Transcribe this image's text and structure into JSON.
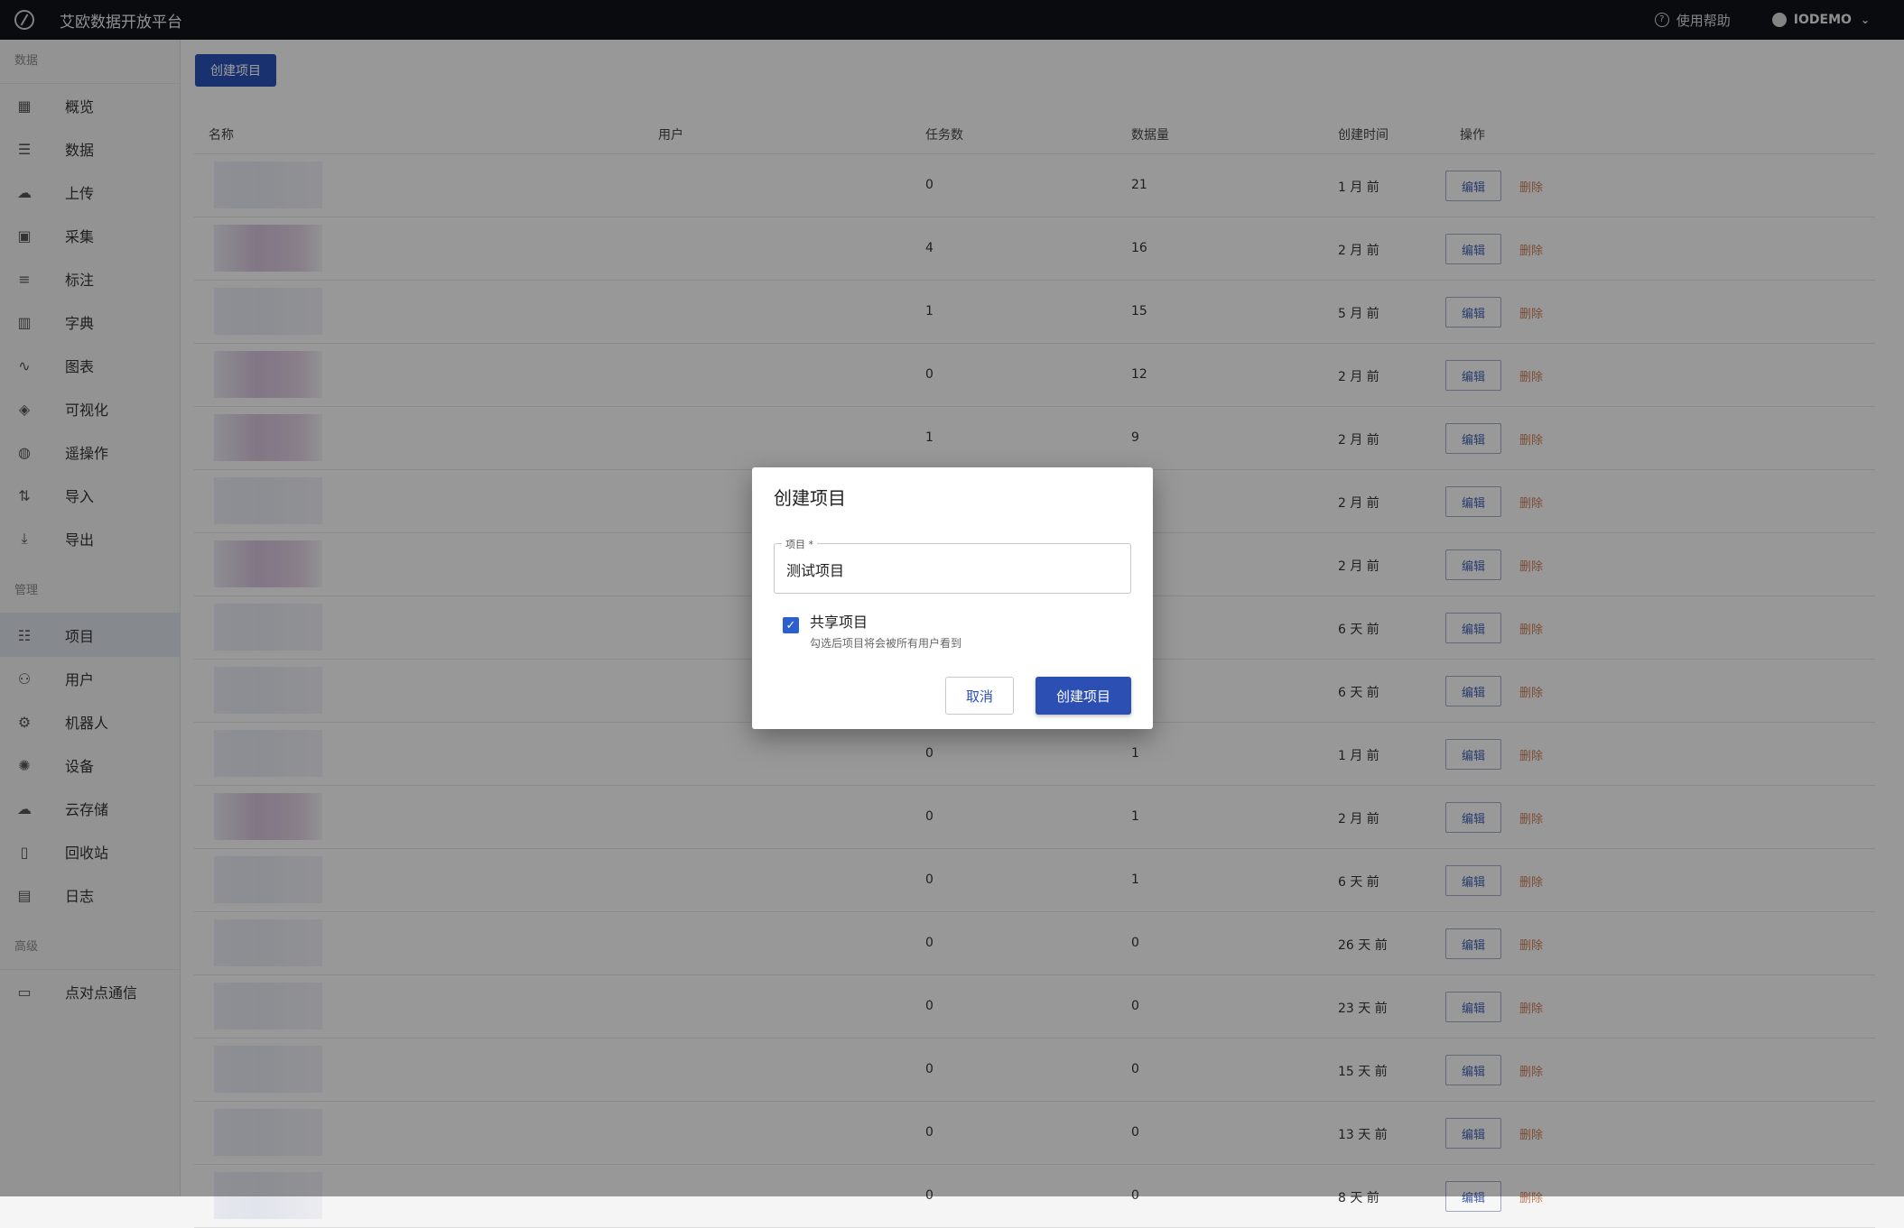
{
  "app": {
    "title": "艾欧数据开放平台"
  },
  "header": {
    "help_label": "使用帮助",
    "user_label": "IODEMO"
  },
  "sidebar": {
    "section_data": "数据",
    "section_manage": "管理",
    "section_advanced": "高级",
    "data_items": [
      {
        "label": "概览",
        "icon": "dashboard-icon"
      },
      {
        "label": "数据",
        "icon": "list-icon"
      },
      {
        "label": "上传",
        "icon": "cloud-upload-icon"
      },
      {
        "label": "采集",
        "icon": "video-icon"
      },
      {
        "label": "标注",
        "icon": "bullet-list-icon"
      },
      {
        "label": "字典",
        "icon": "book-icon"
      },
      {
        "label": "图表",
        "icon": "chart-icon"
      },
      {
        "label": "可视化",
        "icon": "visual-icon"
      },
      {
        "label": "遥操作",
        "icon": "gamepad-icon"
      },
      {
        "label": "导入",
        "icon": "import-icon"
      },
      {
        "label": "导出",
        "icon": "download-icon"
      }
    ],
    "manage_items": [
      {
        "label": "项目",
        "icon": "project-icon"
      },
      {
        "label": "用户",
        "icon": "users-icon"
      },
      {
        "label": "机器人",
        "icon": "robot-icon"
      },
      {
        "label": "设备",
        "icon": "device-icon"
      },
      {
        "label": "云存储",
        "icon": "cloud-icon"
      },
      {
        "label": "回收站",
        "icon": "trash-icon"
      },
      {
        "label": "日志",
        "icon": "clipboard-icon"
      }
    ],
    "advanced_items": [
      {
        "label": "点对点通信",
        "icon": "chat-icon"
      }
    ]
  },
  "main": {
    "create_button": "创建项目",
    "columns": {
      "name": "名称",
      "user": "用户",
      "tasks": "任务数",
      "data": "数据量",
      "created": "创建时间",
      "actions": "操作"
    },
    "edit_label": "编辑",
    "delete_label": "删除",
    "rows": [
      {
        "tasks": "0",
        "data": "21",
        "created": "1 月 前"
      },
      {
        "tasks": "4",
        "data": "16",
        "created": "2 月 前"
      },
      {
        "tasks": "1",
        "data": "15",
        "created": "5 月 前"
      },
      {
        "tasks": "0",
        "data": "12",
        "created": "2 月 前"
      },
      {
        "tasks": "1",
        "data": "9",
        "created": "2 月 前"
      },
      {
        "tasks": "",
        "data": "",
        "created": "2 月 前"
      },
      {
        "tasks": "",
        "data": "",
        "created": "2 月 前"
      },
      {
        "tasks": "",
        "data": "",
        "created": "6 天 前"
      },
      {
        "tasks": "",
        "data": "",
        "created": "6 天 前"
      },
      {
        "tasks": "0",
        "data": "1",
        "created": "1 月 前"
      },
      {
        "tasks": "0",
        "data": "1",
        "created": "2 月 前"
      },
      {
        "tasks": "0",
        "data": "1",
        "created": "6 天 前"
      },
      {
        "tasks": "0",
        "data": "0",
        "created": "26 天 前"
      },
      {
        "tasks": "0",
        "data": "0",
        "created": "23 天 前"
      },
      {
        "tasks": "0",
        "data": "0",
        "created": "15 天 前"
      },
      {
        "tasks": "0",
        "data": "0",
        "created": "13 天 前"
      },
      {
        "tasks": "0",
        "data": "0",
        "created": "8 天 前"
      }
    ]
  },
  "dialog": {
    "title": "创建项目",
    "field_label": "项目 *",
    "field_value": "测试项目",
    "checkbox_label": "共享项目",
    "checkbox_help": "勾选后项目将会被所有用户看到",
    "checkbox_checked": true,
    "cancel_label": "取消",
    "create_label": "创建项目"
  }
}
